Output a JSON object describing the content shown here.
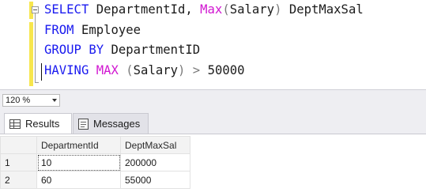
{
  "editor": {
    "lines": [
      [
        {
          "t": "SELECT ",
          "c": "kw"
        },
        {
          "t": "DepartmentId, ",
          "c": "id"
        },
        {
          "t": "Max",
          "c": "fn"
        },
        {
          "t": "(",
          "c": "op"
        },
        {
          "t": "Salary",
          "c": "id"
        },
        {
          "t": ")",
          "c": "op"
        },
        {
          "t": " DeptMaxSal",
          "c": "id"
        }
      ],
      [
        {
          "t": "FROM ",
          "c": "kw"
        },
        {
          "t": "Employee",
          "c": "id"
        }
      ],
      [
        {
          "t": "GROUP BY ",
          "c": "kw"
        },
        {
          "t": "DepartmentID",
          "c": "id"
        }
      ],
      [
        {
          "t": "HAVING ",
          "c": "kw"
        },
        {
          "t": "MAX",
          "c": "fn"
        },
        {
          "t": " (",
          "c": "op"
        },
        {
          "t": "Salary",
          "c": "id"
        },
        {
          "t": ")",
          "c": "op"
        },
        {
          "t": " > ",
          "c": "op"
        },
        {
          "t": "50000",
          "c": "id"
        }
      ]
    ]
  },
  "zoom": {
    "value": "120 %"
  },
  "tabs": {
    "results": "Results",
    "messages": "Messages"
  },
  "grid": {
    "columns": [
      "DepartmentId",
      "DeptMaxSal"
    ],
    "rows": [
      {
        "num": "1",
        "cells": [
          "10",
          "200000"
        ]
      },
      {
        "num": "2",
        "cells": [
          "60",
          "55000"
        ]
      }
    ]
  },
  "colors": {
    "keyword": "#1a1aef",
    "function": "#d116d1",
    "operator": "#7b7b7b",
    "change_marker": "#f7e64d"
  }
}
